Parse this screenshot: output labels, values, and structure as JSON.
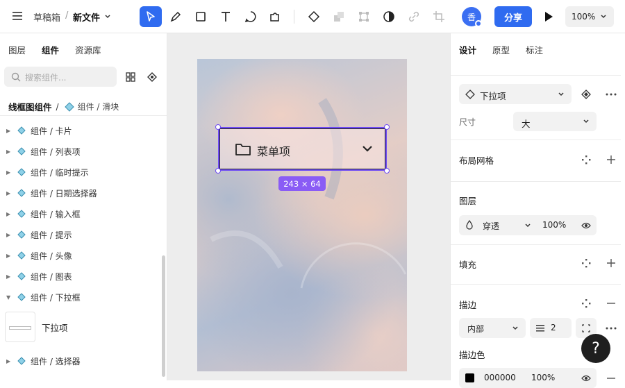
{
  "breadcrumb": {
    "folder": "草稿箱",
    "separator": "/",
    "file": "新文件"
  },
  "header": {
    "avatar_text": "香",
    "share_label": "分享",
    "zoom": "100%"
  },
  "left_panel": {
    "tabs": [
      "图层",
      "组件",
      "资源库"
    ],
    "search_placeholder": "搜索组件...",
    "path_root": "线框图组件",
    "path_sep": "/",
    "path_current": "组件 / 滑块",
    "items": [
      "组件 / 卡片",
      "组件 / 列表项",
      "组件 / 临时提示",
      "组件 / 日期选择器",
      "组件 / 输入框",
      "组件 / 提示",
      "组件 / 头像",
      "组件 / 图表",
      "组件 / 下拉框"
    ],
    "expanded_child": "下拉项",
    "last_item": "组件 / 选择器"
  },
  "canvas": {
    "menu_label": "菜单项",
    "size_badge": "243 × 64"
  },
  "right_panel": {
    "tabs": [
      "设计",
      "原型",
      "标注"
    ],
    "component_name": "下拉项",
    "size_label": "尺寸",
    "size_value": "大",
    "layout_grid": "布局网格",
    "layer": "图层",
    "blend_mode": "穿透",
    "opacity": "100%",
    "fill": "填充",
    "stroke": "描边",
    "stroke_position": "内部",
    "stroke_width": "2",
    "stroke_color_label": "描边色",
    "stroke_color_hex": "000000",
    "stroke_color_opacity": "100%"
  },
  "help_label": "?",
  "colors": {
    "accent": "#2f6bf0",
    "selection": "#6e4bf5",
    "badge": "#8a5cf5"
  }
}
